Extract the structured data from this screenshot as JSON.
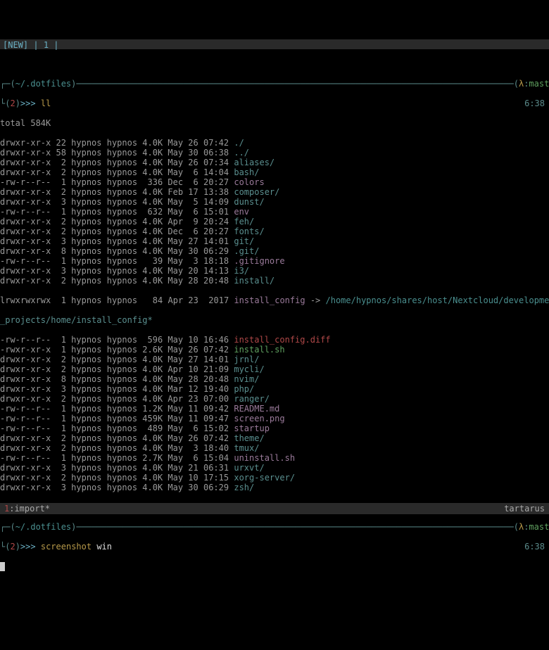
{
  "tabbar": {
    "new_label": "[NEW]",
    "sep": " | ",
    "idx": "1",
    "trail": " |"
  },
  "prompt1": {
    "path": "~/.dotfiles",
    "lambda": "λ",
    "branch": "master",
    "idx": "2",
    "arrows": ">>>",
    "cmd": "ll",
    "time": "6:38"
  },
  "listing": {
    "total": "total 584K",
    "rows": [
      {
        "perms": "drwxr-xr-x",
        "links": "22",
        "owner": "hypnos",
        "group": "hypnos",
        "size": "4.0K",
        "date": "May 26 07:42",
        "name": "./",
        "cls": "dir"
      },
      {
        "perms": "drwxr-xr-x",
        "links": "58",
        "owner": "hypnos",
        "group": "hypnos",
        "size": "4.0K",
        "date": "May 30 06:38",
        "name": "../",
        "cls": "dir"
      },
      {
        "perms": "drwxr-xr-x",
        "links": " 2",
        "owner": "hypnos",
        "group": "hypnos",
        "size": "4.0K",
        "date": "May 26 07:34",
        "name": "aliases/",
        "cls": "dir"
      },
      {
        "perms": "drwxr-xr-x",
        "links": " 2",
        "owner": "hypnos",
        "group": "hypnos",
        "size": "4.0K",
        "date": "May  6 14:04",
        "name": "bash/",
        "cls": "dir"
      },
      {
        "perms": "-rw-r--r--",
        "links": " 1",
        "owner": "hypnos",
        "group": "hypnos",
        "size": " 336",
        "date": "Dec  6 20:27",
        "name": "colors",
        "cls": "link"
      },
      {
        "perms": "drwxr-xr-x",
        "links": " 2",
        "owner": "hypnos",
        "group": "hypnos",
        "size": "4.0K",
        "date": "Feb 17 13:38",
        "name": "composer/",
        "cls": "dir"
      },
      {
        "perms": "drwxr-xr-x",
        "links": " 3",
        "owner": "hypnos",
        "group": "hypnos",
        "size": "4.0K",
        "date": "May  5 14:09",
        "name": "dunst/",
        "cls": "dir"
      },
      {
        "perms": "-rw-r--r--",
        "links": " 1",
        "owner": "hypnos",
        "group": "hypnos",
        "size": " 632",
        "date": "May  6 15:01",
        "name": "env",
        "cls": "link"
      },
      {
        "perms": "drwxr-xr-x",
        "links": " 2",
        "owner": "hypnos",
        "group": "hypnos",
        "size": "4.0K",
        "date": "Apr  9 20:24",
        "name": "feh/",
        "cls": "dir"
      },
      {
        "perms": "drwxr-xr-x",
        "links": " 2",
        "owner": "hypnos",
        "group": "hypnos",
        "size": "4.0K",
        "date": "Dec  6 20:27",
        "name": "fonts/",
        "cls": "dir"
      },
      {
        "perms": "drwxr-xr-x",
        "links": " 3",
        "owner": "hypnos",
        "group": "hypnos",
        "size": "4.0K",
        "date": "May 27 14:01",
        "name": "git/",
        "cls": "dir"
      },
      {
        "perms": "drwxr-xr-x",
        "links": " 8",
        "owner": "hypnos",
        "group": "hypnos",
        "size": "4.0K",
        "date": "May 30 06:29",
        "name": ".git/",
        "cls": "dir"
      },
      {
        "perms": "-rw-r--r--",
        "links": " 1",
        "owner": "hypnos",
        "group": "hypnos",
        "size": "  39",
        "date": "May  3 18:18",
        "name": ".gitignore",
        "cls": "link"
      },
      {
        "perms": "drwxr-xr-x",
        "links": " 3",
        "owner": "hypnos",
        "group": "hypnos",
        "size": "4.0K",
        "date": "May 20 14:13",
        "name": "i3/",
        "cls": "dir"
      },
      {
        "perms": "drwxr-xr-x",
        "links": " 2",
        "owner": "hypnos",
        "group": "hypnos",
        "size": "4.0K",
        "date": "May 28 20:48",
        "name": "install/",
        "cls": "dir"
      }
    ],
    "symlink": {
      "perms": "lrwxrwxrwx",
      "links": " 1",
      "owner": "hypnos",
      "group": "hypnos",
      "size": "  84",
      "date": "Apr 23  2017",
      "name": "install_config",
      "arrow": " -> ",
      "target": "/home/hypnos/shares/host/Nextcloud/development/dotfiles",
      "wrap": "_projects/home/install_config*"
    },
    "rows2": [
      {
        "perms": "-rw-r--r--",
        "links": " 1",
        "owner": "hypnos",
        "group": "hypnos",
        "size": " 596",
        "date": "May 10 16:46",
        "name": "install_config.diff",
        "cls": "diff"
      },
      {
        "perms": "-rwxr-xr-x",
        "links": " 1",
        "owner": "hypnos",
        "group": "hypnos",
        "size": "2.6K",
        "date": "May 26 07:42",
        "name": "install.sh",
        "cls": "exec"
      },
      {
        "perms": "drwxr-xr-x",
        "links": " 2",
        "owner": "hypnos",
        "group": "hypnos",
        "size": "4.0K",
        "date": "May 27 14:01",
        "name": "jrnl/",
        "cls": "dir"
      },
      {
        "perms": "drwxr-xr-x",
        "links": " 2",
        "owner": "hypnos",
        "group": "hypnos",
        "size": "4.0K",
        "date": "Apr 10 21:09",
        "name": "mycli/",
        "cls": "dir"
      },
      {
        "perms": "drwxr-xr-x",
        "links": " 8",
        "owner": "hypnos",
        "group": "hypnos",
        "size": "4.0K",
        "date": "May 28 20:48",
        "name": "nvim/",
        "cls": "dir"
      },
      {
        "perms": "drwxr-xr-x",
        "links": " 3",
        "owner": "hypnos",
        "group": "hypnos",
        "size": "4.0K",
        "date": "Mar 12 19:40",
        "name": "php/",
        "cls": "dir"
      },
      {
        "perms": "drwxr-xr-x",
        "links": " 2",
        "owner": "hypnos",
        "group": "hypnos",
        "size": "4.0K",
        "date": "Apr 23 07:00",
        "name": "ranger/",
        "cls": "dir"
      },
      {
        "perms": "-rw-r--r--",
        "links": " 1",
        "owner": "hypnos",
        "group": "hypnos",
        "size": "1.2K",
        "date": "May 11 09:42",
        "name": "README.md",
        "cls": "link"
      },
      {
        "perms": "-rw-r--r--",
        "links": " 1",
        "owner": "hypnos",
        "group": "hypnos",
        "size": "459K",
        "date": "May 11 09:47",
        "name": "screen.png",
        "cls": "link"
      },
      {
        "perms": "-rw-r--r--",
        "links": " 1",
        "owner": "hypnos",
        "group": "hypnos",
        "size": " 489",
        "date": "May  6 15:02",
        "name": "startup",
        "cls": "link"
      },
      {
        "perms": "drwxr-xr-x",
        "links": " 2",
        "owner": "hypnos",
        "group": "hypnos",
        "size": "4.0K",
        "date": "May 26 07:42",
        "name": "theme/",
        "cls": "dir"
      },
      {
        "perms": "drwxr-xr-x",
        "links": " 2",
        "owner": "hypnos",
        "group": "hypnos",
        "size": "4.0K",
        "date": "May  3 18:40",
        "name": "tmux/",
        "cls": "dir"
      },
      {
        "perms": "-rw-r--r--",
        "links": " 1",
        "owner": "hypnos",
        "group": "hypnos",
        "size": "2.7K",
        "date": "May  6 15:04",
        "name": "uninstall.sh",
        "cls": "link"
      },
      {
        "perms": "drwxr-xr-x",
        "links": " 3",
        "owner": "hypnos",
        "group": "hypnos",
        "size": "4.0K",
        "date": "May 21 06:31",
        "name": "urxvt/",
        "cls": "dir"
      },
      {
        "perms": "drwxr-xr-x",
        "links": " 2",
        "owner": "hypnos",
        "group": "hypnos",
        "size": "4.0K",
        "date": "May 10 17:15",
        "name": "xorg-server/",
        "cls": "dir"
      },
      {
        "perms": "drwxr-xr-x",
        "links": " 3",
        "owner": "hypnos",
        "group": "hypnos",
        "size": "4.0K",
        "date": "May 30 06:29",
        "name": "zsh/",
        "cls": "dir"
      }
    ]
  },
  "prompt2": {
    "path": "~/.dotfiles",
    "lambda": "λ",
    "branch": "master",
    "idx": "2",
    "arrows": ">>>",
    "cmd": "screenshot",
    "arg": "win",
    "time": "6:38"
  },
  "statusbar": {
    "idx": "1",
    "name": ":import*",
    "host": "tartarus"
  }
}
